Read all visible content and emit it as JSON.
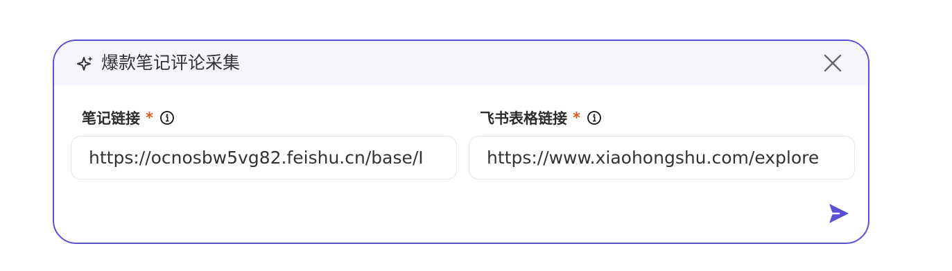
{
  "dialog": {
    "title": "爆款笔记评论采集",
    "title_icon": "sparkle-icon",
    "close_icon": "close-icon",
    "accent_color": "#5b4fd6",
    "header_background": "#f5f5fb"
  },
  "fields": [
    {
      "label": "笔记链接",
      "required_mark": "*",
      "info_icon": "info-icon",
      "value": "https://ocnosbw5vg82.feishu.cn/base/I"
    },
    {
      "label": "飞书表格链接",
      "required_mark": "*",
      "info_icon": "info-icon",
      "value": "https://www.xiaohongshu.com/explore"
    }
  ],
  "actions": {
    "send_icon": "send-icon"
  },
  "colors": {
    "required": "#d45a2a",
    "send": "#5b4fd6"
  }
}
